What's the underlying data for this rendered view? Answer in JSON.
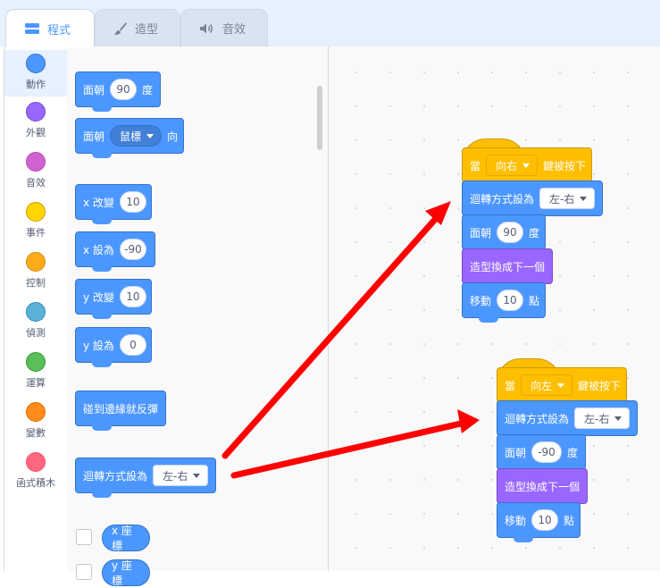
{
  "tabs": [
    {
      "label": "程式",
      "icon": "code-icon",
      "active": true
    },
    {
      "label": "造型",
      "icon": "brush-icon",
      "active": false
    },
    {
      "label": "音效",
      "icon": "speaker-icon",
      "active": false
    }
  ],
  "categories": [
    {
      "label": "動作",
      "color": "#4c97ff"
    },
    {
      "label": "外觀",
      "color": "#9966ff"
    },
    {
      "label": "音效",
      "color": "#cf63cf"
    },
    {
      "label": "事件",
      "color": "#ffd500"
    },
    {
      "label": "控制",
      "color": "#ffab19"
    },
    {
      "label": "偵測",
      "color": "#5cb1d6"
    },
    {
      "label": "運算",
      "color": "#59c059"
    },
    {
      "label": "變數",
      "color": "#ff8c1a"
    },
    {
      "label": "函式積木",
      "color": "#ff6680"
    }
  ],
  "palette": {
    "point_direction": {
      "pre": "面朝",
      "value": "90",
      "post": "度"
    },
    "point_towards": {
      "pre": "面朝",
      "value": "鼠標",
      "post": "向"
    },
    "change_x": {
      "pre": "x 改變",
      "value": "10"
    },
    "set_x": {
      "pre": "x 設為",
      "value": "-90"
    },
    "change_y": {
      "pre": "y 改變",
      "value": "10"
    },
    "set_y": {
      "pre": "y 設為",
      "value": "0"
    },
    "bounce": {
      "label": "碰到邊緣就反彈"
    },
    "rotation_style": {
      "pre": "迴轉方式設為",
      "value": "左-右"
    },
    "x_position": {
      "label": "x 座標"
    },
    "y_position": {
      "label": "y 座標"
    }
  },
  "script1": {
    "hat": {
      "pre": "當",
      "key": "向右",
      "post": "鍵被按下"
    },
    "rotation": {
      "pre": "迴轉方式設為",
      "value": "左-右"
    },
    "point": {
      "pre": "面朝",
      "value": "90",
      "post": "度"
    },
    "costume": {
      "label": "造型換成下一個"
    },
    "move": {
      "pre": "移動",
      "value": "10",
      "post": "點"
    }
  },
  "script2": {
    "hat": {
      "pre": "當",
      "key": "向左",
      "post": "鍵被按下"
    },
    "rotation": {
      "pre": "迴轉方式設為",
      "value": "左-右"
    },
    "point": {
      "pre": "面朝",
      "value": "-90",
      "post": "度"
    },
    "costume": {
      "label": "造型換成下一個"
    },
    "move": {
      "pre": "移動",
      "value": "10",
      "post": "點"
    }
  },
  "colors": {
    "motion": "#4c97ff",
    "looks": "#9966ff",
    "events": "#ffbf00",
    "arrow": "#ff0000"
  }
}
